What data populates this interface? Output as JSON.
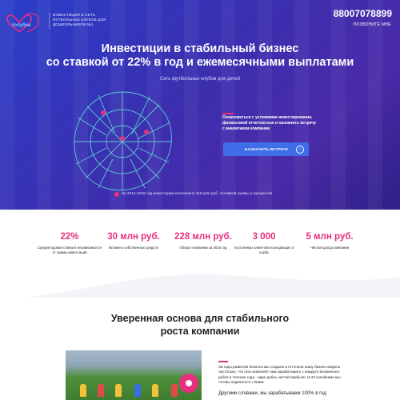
{
  "header": {
    "logo_text": "ГОЛУБКА",
    "tagline": "ИНВЕСТИЦИИ В СЕТЬ ФУТБОЛЬНЫХ КЛУБОВ ДЛЯ ДОШКОЛЬНИКОВ №1",
    "phone": "88007078899",
    "callback": "ПОЗВОНИТЕ МНЕ"
  },
  "hero": {
    "title_line1": "Инвестиции в стабильный бизнес",
    "title_line2": "со ставкой от 22% в год и ежемесячными выплатами",
    "subtitle": "Сеть футбольных клубов для детей",
    "offer_text": "Ознакомиться с условиями инвестирования, финансовой отчетностью и назначить встречу с аналитиком компании",
    "cta_label": "НАЗНАЧИТЬ ВСТРЕЧУ",
    "footnote": "За 2014-2015 год инвесторам выплачено 110 млн руб. основной суммы и процентов"
  },
  "stats": [
    {
      "value": "22%",
      "label": "Среднегодовая ставка в независимости от суммы инвестиций"
    },
    {
      "value": "30 млн руб.",
      "label": "Вложено собственных средств"
    },
    {
      "value": "228 млн руб.",
      "label": "Оборот компании за 2015 год"
    },
    {
      "value": "3 000",
      "label": "постоянных клиентов посещающих 3 клуба"
    },
    {
      "value": "5 млн руб.",
      "label": "Чистый доход компании"
    }
  ],
  "section2": {
    "title": "Уверенная основа для стабильного роста компании",
    "text": "За годы развития бизнеса мы создали и отточили нашу бизнес-модель настолько, что она позволяет нам зарабатывать с каждого вложенного рубля в течение года - один рубль чистой прибыли. И 22 копейками мы готовы поделиться с Вами.",
    "text2": "Другими словами, мы зарабатываем 100% в год"
  },
  "colors": {
    "accent": "#e6307f",
    "hero_blue": "#2f3fc0",
    "button": "#3f6ee8"
  }
}
